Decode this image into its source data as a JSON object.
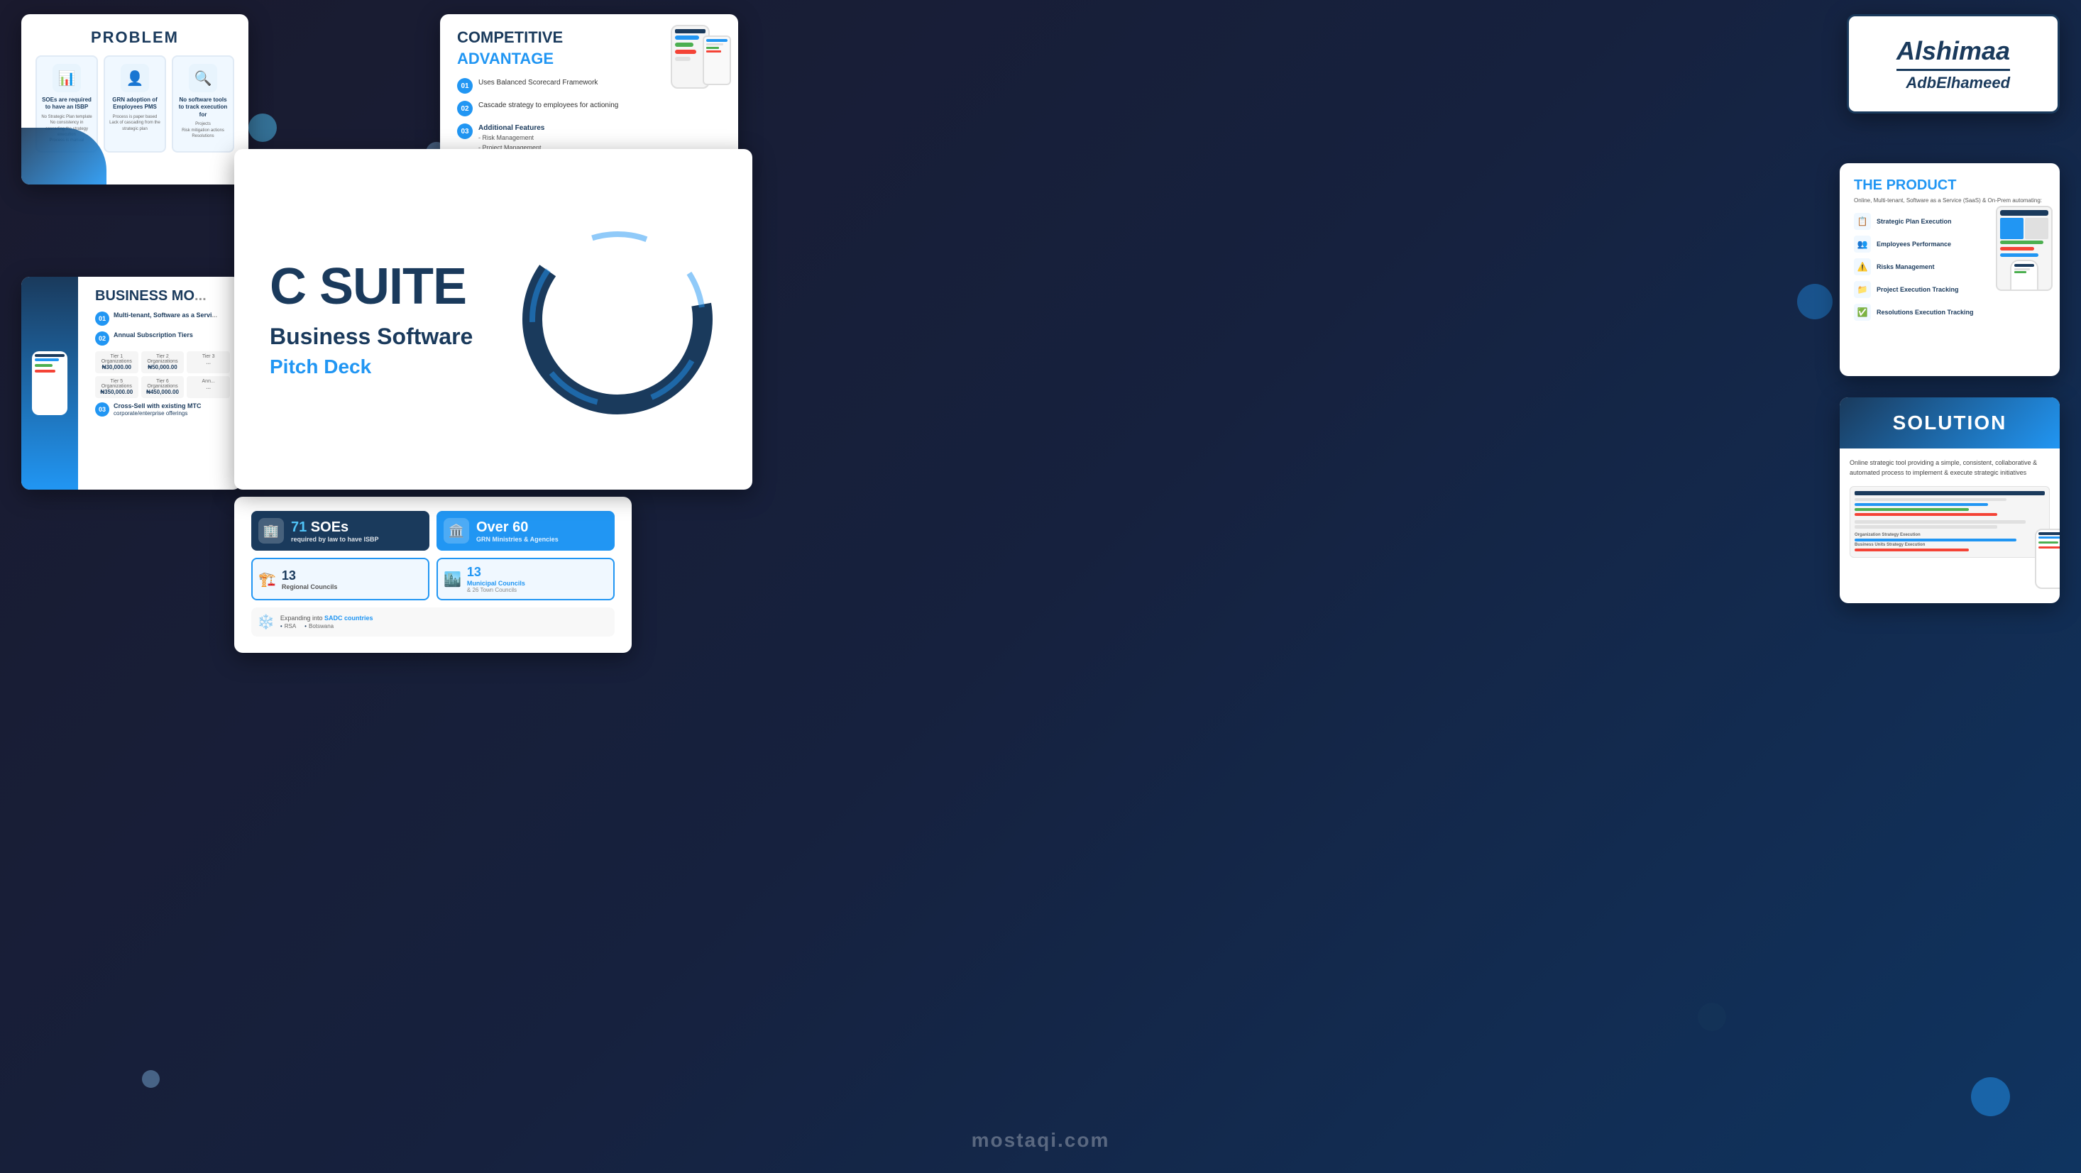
{
  "page": {
    "title": "C Suite Business Software - Pitch Deck Presentation"
  },
  "main_slide": {
    "title": "C SUITE",
    "subtitle": "Business Software",
    "pitch": "Pitch Deck"
  },
  "problem_slide": {
    "title": "PROBLEM",
    "cards": [
      {
        "heading": "SOEs are required to have an ISBP",
        "body": "No Strategic Plan template\nNo consistency in cascading the strategy execution to all levels of the organization\nNo consistency in monitoring & reviewing strategic plan execution Process is manual"
      },
      {
        "heading": "GRN adoption of Employees PMS",
        "body": "Process is paper based\nLack of cascading from the strategic plan"
      },
      {
        "heading": "No software tools to track execution for",
        "body": "Projects\nRisk mitigation actions\nResolutions"
      }
    ]
  },
  "competitive_slide": {
    "title": "COMPETITIVE",
    "subtitle": "ADVANTAGE",
    "items": [
      {
        "num": "01",
        "text": "Uses Balanced Scorecard Framework"
      },
      {
        "num": "02",
        "text": "Cascade strategy to employees for actioning"
      },
      {
        "num": "03",
        "text": "Additional Features",
        "sub": "Risk Management\nProject Management"
      }
    ]
  },
  "logo_slide": {
    "name": "Alshimaa",
    "sub": "AdbElhameed"
  },
  "product_slide": {
    "title_plain": "THE",
    "title_colored": "PRODUCT",
    "desc": "Online, Multi-tenant, Software as a Service (SaaS) & On-Prem automating:",
    "features": [
      "Strategic Plan Execution",
      "Employees Performance",
      "Risks Management",
      "Project Execution Tracking",
      "Resolutions Execution Tracking"
    ]
  },
  "business_slide": {
    "title": "BUSINESS MO...",
    "items": [
      {
        "num": "01",
        "text": "Multi-tenant, Software as a Servi..."
      },
      {
        "num": "02",
        "text": "Annual Subscription Tiers"
      },
      {
        "num": "03",
        "text": "Cross-Sell with existing MTC corporate/enterprise offerings"
      }
    ],
    "tiers": [
      {
        "label": "Tier 1 Organizations",
        "price": "₦30,000.00"
      },
      {
        "label": "Tier 2 Organizations",
        "price": "₦50,000.00"
      },
      {
        "label": "Tier 3",
        "price": "..."
      },
      {
        "label": "Tier 5 Organizations",
        "price": "₦350,000.00"
      },
      {
        "label": "Tier 6 Organizations",
        "price": "₦450,000.00"
      },
      {
        "label": "Ann...",
        "price": "..."
      }
    ]
  },
  "market_slide": {
    "stats": [
      {
        "num": "71",
        "label": "SOEs",
        "sub": "required by law to have ISBP",
        "type": "blue"
      },
      {
        "num": "Over 60",
        "label": "GRN Ministries & Agencies",
        "type": "light-blue"
      },
      {
        "num": "13",
        "label": "Regional Councils",
        "type": "small-blue"
      },
      {
        "num": "13",
        "label": "Municipal Councils",
        "sub": "& 26 Town Councils",
        "type": "small-light"
      }
    ],
    "expand": {
      "title": "Expanding into SADC countries",
      "countries": [
        "RSA",
        "Botswana"
      ]
    }
  },
  "solution_slide": {
    "title": "SOLUTION",
    "desc": "Online strategic tool providing a simple, consistent, collaborative & automated process to implement & execute strategic initiatives"
  },
  "watermark": "mostaqi.com"
}
